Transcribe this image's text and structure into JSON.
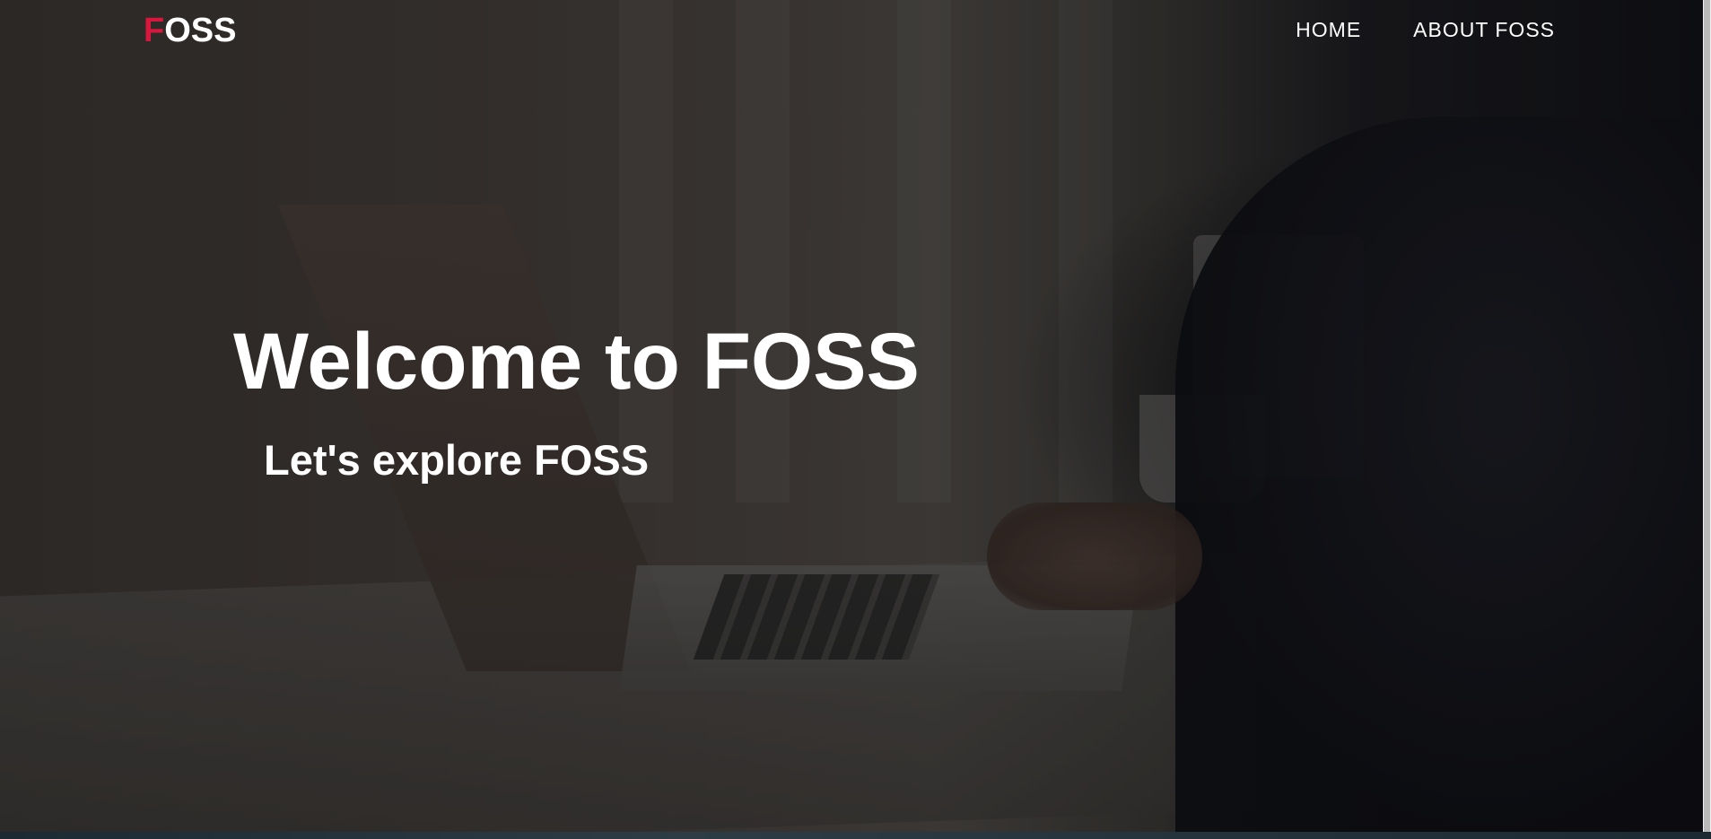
{
  "brand": {
    "logo_first_letter": "F",
    "logo_rest": "OSS",
    "accent_color": "#d8173e"
  },
  "nav": {
    "items": [
      {
        "label": "HOME"
      },
      {
        "label": "ABOUT FOSS"
      }
    ]
  },
  "hero": {
    "title": "Welcome to FOSS",
    "subtitle": "Let's explore FOSS",
    "background": "dimmed photo of person typing on laptop"
  }
}
